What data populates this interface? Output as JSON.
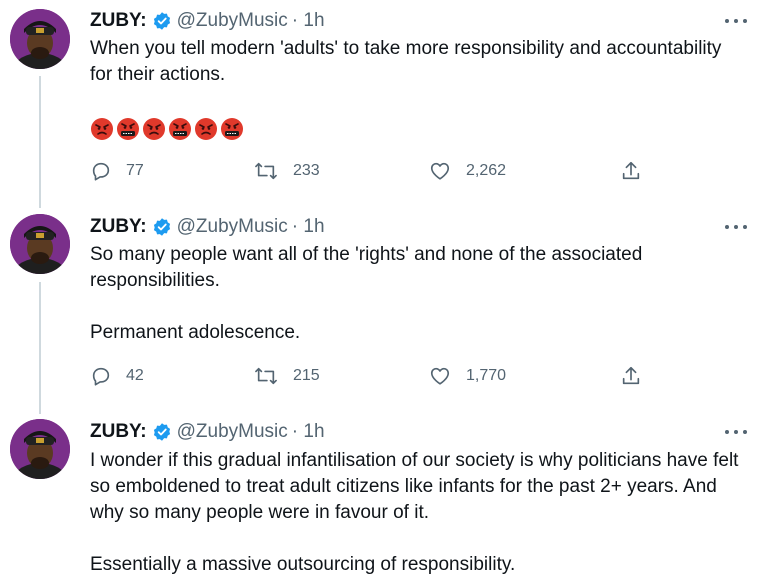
{
  "tweets": [
    {
      "name": "ZUBY:",
      "handle": "@ZubyMusic",
      "time": "· 1h",
      "paragraphs": [
        "When you tell modern 'adults' to take more responsibility and accountability for their actions."
      ],
      "emojis": [
        "😡",
        "🤬",
        "😡",
        "🤬",
        "😡",
        "🤬"
      ],
      "replies": "77",
      "retweets": "233",
      "likes": "2,262"
    },
    {
      "name": "ZUBY:",
      "handle": "@ZubyMusic",
      "time": "· 1h",
      "paragraphs": [
        "So many people want all of the 'rights' and none of the associated responsibilities.",
        "Permanent adolescence."
      ],
      "replies": "42",
      "retweets": "215",
      "likes": "1,770"
    },
    {
      "name": "ZUBY:",
      "handle": "@ZubyMusic",
      "time": "· 1h",
      "paragraphs": [
        "I wonder if this gradual infantilisation of our society is why politicians have felt so emboldened to treat adult citizens like infants for the past 2+ years. And why so many people were in favour of it.",
        "Essentially a massive outsourcing of responsibility."
      ]
    }
  ],
  "colors": {
    "verified": "#1d9bf0",
    "secondary_text": "#536471",
    "avatar_bg": "#7a2f8a",
    "thread_line": "#cfd9de"
  }
}
